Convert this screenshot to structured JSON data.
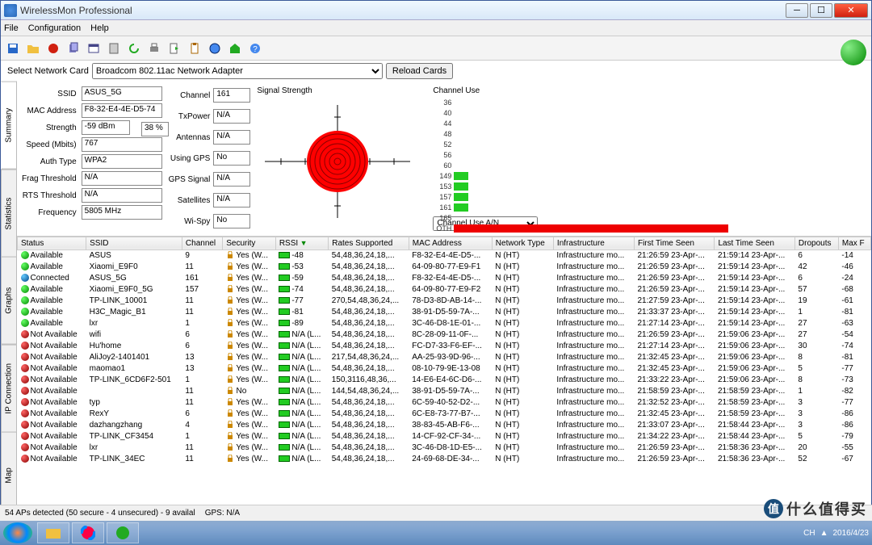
{
  "window": {
    "title": "WirelessMon Professional"
  },
  "menu": {
    "file": "File",
    "configuration": "Configuration",
    "help": "Help"
  },
  "cardrow": {
    "label": "Select Network Card",
    "selected": "Broadcom 802.11ac Network Adapter",
    "reload": "Reload Cards"
  },
  "sidetabs": {
    "summary": "Summary",
    "statistics": "Statistics",
    "graphs": "Graphs",
    "ipconn": "IP Connection",
    "map": "Map"
  },
  "fields_left": {
    "ssid_lbl": "SSID",
    "ssid": "ASUS_5G",
    "mac_lbl": "MAC Address",
    "mac": "F8-32-E4-4E-D5-74",
    "strength_lbl": "Strength",
    "strength": "-59 dBm",
    "strength_pct": "38 %",
    "speed_lbl": "Speed (Mbits)",
    "speed": "767",
    "auth_lbl": "Auth Type",
    "auth": "WPA2",
    "frag_lbl": "Frag Threshold",
    "frag": "N/A",
    "rts_lbl": "RTS Threshold",
    "rts": "N/A",
    "freq_lbl": "Frequency",
    "freq": "5805 MHz"
  },
  "fields_right": {
    "channel_lbl": "Channel",
    "channel": "161",
    "txpower_lbl": "TxPower",
    "txpower": "N/A",
    "antennas_lbl": "Antennas",
    "antennas": "N/A",
    "gps_lbl": "Using GPS",
    "gps": "No",
    "gpssig_lbl": "GPS Signal",
    "gpssig": "N/A",
    "sat_lbl": "Satellites",
    "sat": "N/A",
    "wispy_lbl": "Wi-Spy",
    "wispy": "No"
  },
  "radar": {
    "hdr": "Signal Strength"
  },
  "chuse": {
    "hdr": "Channel Use",
    "labels": [
      "36",
      "40",
      "44",
      "48",
      "52",
      "56",
      "60",
      "149",
      "153",
      "157",
      "161",
      "165",
      "OTH"
    ],
    "dropdown": "Channel Use A/N"
  },
  "columns": [
    "Status",
    "SSID",
    "Channel",
    "Security",
    "RSSI",
    "Rates Supported",
    "MAC Address",
    "Network Type",
    "Infrastructure",
    "First Time Seen",
    "Last Time Seen",
    "Dropouts",
    "Max F"
  ],
  "rows": [
    {
      "st": "g",
      "status": "Available",
      "ssid": "ASUS",
      "ch": "9",
      "sec": "Yes (W...",
      "rssi": "-48",
      "rates": "54,48,36,24,18,...",
      "mac": "F8-32-E4-4E-D5-...",
      "nt": "N (HT)",
      "inf": "Infrastructure mo...",
      "fts": "21:26:59 23-Apr-...",
      "lts": "21:59:14 23-Apr-...",
      "drop": "6",
      "maxf": "-14"
    },
    {
      "st": "g",
      "status": "Available",
      "ssid": "Xiaomi_E9F0",
      "ch": "11",
      "sec": "Yes (W...",
      "rssi": "-53",
      "rates": "54,48,36,24,18,...",
      "mac": "64-09-80-77-E9-F1",
      "nt": "N (HT)",
      "inf": "Infrastructure mo...",
      "fts": "21:26:59 23-Apr-...",
      "lts": "21:59:14 23-Apr-...",
      "drop": "42",
      "maxf": "-46"
    },
    {
      "st": "b",
      "status": "Connected",
      "ssid": "ASUS_5G",
      "ch": "161",
      "sec": "Yes (W...",
      "rssi": "-59",
      "rates": "54,48,36,24,18,...",
      "mac": "F8-32-E4-4E-D5-...",
      "nt": "N (HT)",
      "inf": "Infrastructure mo...",
      "fts": "21:26:59 23-Apr-...",
      "lts": "21:59:14 23-Apr-...",
      "drop": "6",
      "maxf": "-24"
    },
    {
      "st": "g",
      "status": "Available",
      "ssid": "Xiaomi_E9F0_5G",
      "ch": "157",
      "sec": "Yes (W...",
      "rssi": "-74",
      "rates": "54,48,36,24,18,...",
      "mac": "64-09-80-77-E9-F2",
      "nt": "N (HT)",
      "inf": "Infrastructure mo...",
      "fts": "21:26:59 23-Apr-...",
      "lts": "21:59:14 23-Apr-...",
      "drop": "57",
      "maxf": "-68"
    },
    {
      "st": "g",
      "status": "Available",
      "ssid": "TP-LINK_10001",
      "ch": "11",
      "sec": "Yes (W...",
      "rssi": "-77",
      "rates": "270,54,48,36,24,...",
      "mac": "78-D3-8D-AB-14-...",
      "nt": "N (HT)",
      "inf": "Infrastructure mo...",
      "fts": "21:27:59 23-Apr-...",
      "lts": "21:59:14 23-Apr-...",
      "drop": "19",
      "maxf": "-61"
    },
    {
      "st": "g",
      "status": "Available",
      "ssid": "H3C_Magic_B1",
      "ch": "11",
      "sec": "Yes (W...",
      "rssi": "-81",
      "rates": "54,48,36,24,18,...",
      "mac": "38-91-D5-59-7A-...",
      "nt": "N (HT)",
      "inf": "Infrastructure mo...",
      "fts": "21:33:37 23-Apr-...",
      "lts": "21:59:14 23-Apr-...",
      "drop": "1",
      "maxf": "-81"
    },
    {
      "st": "g",
      "status": "Available",
      "ssid": "lxr",
      "ch": "1",
      "sec": "Yes (W...",
      "rssi": "-89",
      "rates": "54,48,36,24,18,...",
      "mac": "3C-46-D8-1E-01-...",
      "nt": "N (HT)",
      "inf": "Infrastructure mo...",
      "fts": "21:27:14 23-Apr-...",
      "lts": "21:59:14 23-Apr-...",
      "drop": "27",
      "maxf": "-63"
    },
    {
      "st": "r",
      "status": "Not Available",
      "ssid": "wifi",
      "ch": "6",
      "sec": "Yes (W...",
      "rssi": "N/A (L...",
      "rates": "54,48,36,24,18,...",
      "mac": "8C-28-09-11-0F-...",
      "nt": "N (HT)",
      "inf": "Infrastructure mo...",
      "fts": "21:26:59 23-Apr-...",
      "lts": "21:59:06 23-Apr-...",
      "drop": "27",
      "maxf": "-54"
    },
    {
      "st": "r",
      "status": "Not Available",
      "ssid": "Hu'home",
      "ch": "6",
      "sec": "Yes (W...",
      "rssi": "N/A (L...",
      "rates": "54,48,36,24,18,...",
      "mac": "FC-D7-33-F6-EF-...",
      "nt": "N (HT)",
      "inf": "Infrastructure mo...",
      "fts": "21:27:14 23-Apr-...",
      "lts": "21:59:06 23-Apr-...",
      "drop": "30",
      "maxf": "-74"
    },
    {
      "st": "r",
      "status": "Not Available",
      "ssid": "AliJoy2-1401401",
      "ch": "13",
      "sec": "Yes (W...",
      "rssi": "N/A (L...",
      "rates": "217,54,48,36,24,...",
      "mac": "AA-25-93-9D-96-...",
      "nt": "N (HT)",
      "inf": "Infrastructure mo...",
      "fts": "21:32:45 23-Apr-...",
      "lts": "21:59:06 23-Apr-...",
      "drop": "8",
      "maxf": "-81"
    },
    {
      "st": "r",
      "status": "Not Available",
      "ssid": "maomao1",
      "ch": "13",
      "sec": "Yes (W...",
      "rssi": "N/A (L...",
      "rates": "54,48,36,24,18,...",
      "mac": "08-10-79-9E-13-08",
      "nt": "N (HT)",
      "inf": "Infrastructure mo...",
      "fts": "21:32:45 23-Apr-...",
      "lts": "21:59:06 23-Apr-...",
      "drop": "5",
      "maxf": "-77"
    },
    {
      "st": "r",
      "status": "Not Available",
      "ssid": "TP-LINK_6CD6F2-501",
      "ch": "1",
      "sec": "Yes (W...",
      "rssi": "N/A (L...",
      "rates": "150,3116,48,36,...",
      "mac": "14-E6-E4-6C-D6-...",
      "nt": "N (HT)",
      "inf": "Infrastructure mo...",
      "fts": "21:33:22 23-Apr-...",
      "lts": "21:59:06 23-Apr-...",
      "drop": "8",
      "maxf": "-73"
    },
    {
      "st": "r",
      "status": "Not Available",
      "ssid": "",
      "ch": "11",
      "sec": "No",
      "rssi": "N/A (L...",
      "rates": "144,54,48,36,24,...",
      "mac": "38-91-D5-59-7A-...",
      "nt": "N (HT)",
      "inf": "Infrastructure mo...",
      "fts": "21:58:59 23-Apr-...",
      "lts": "21:58:59 23-Apr-...",
      "drop": "1",
      "maxf": "-82"
    },
    {
      "st": "r",
      "status": "Not Available",
      "ssid": "typ",
      "ch": "11",
      "sec": "Yes (W...",
      "rssi": "N/A (L...",
      "rates": "54,48,36,24,18,...",
      "mac": "6C-59-40-52-D2-...",
      "nt": "N (HT)",
      "inf": "Infrastructure mo...",
      "fts": "21:32:52 23-Apr-...",
      "lts": "21:58:59 23-Apr-...",
      "drop": "3",
      "maxf": "-77"
    },
    {
      "st": "r",
      "status": "Not Available",
      "ssid": "RexY",
      "ch": "6",
      "sec": "Yes (W...",
      "rssi": "N/A (L...",
      "rates": "54,48,36,24,18,...",
      "mac": "6C-E8-73-77-B7-...",
      "nt": "N (HT)",
      "inf": "Infrastructure mo...",
      "fts": "21:32:45 23-Apr-...",
      "lts": "21:58:59 23-Apr-...",
      "drop": "3",
      "maxf": "-86"
    },
    {
      "st": "r",
      "status": "Not Available",
      "ssid": "dazhangzhang",
      "ch": "4",
      "sec": "Yes (W...",
      "rssi": "N/A (L...",
      "rates": "54,48,36,24,18,...",
      "mac": "38-83-45-AB-F6-...",
      "nt": "N (HT)",
      "inf": "Infrastructure mo...",
      "fts": "21:33:07 23-Apr-...",
      "lts": "21:58:44 23-Apr-...",
      "drop": "3",
      "maxf": "-86"
    },
    {
      "st": "r",
      "status": "Not Available",
      "ssid": "TP-LINK_CF3454",
      "ch": "1",
      "sec": "Yes (W...",
      "rssi": "N/A (L...",
      "rates": "54,48,36,24,18,...",
      "mac": "14-CF-92-CF-34-...",
      "nt": "N (HT)",
      "inf": "Infrastructure mo...",
      "fts": "21:34:22 23-Apr-...",
      "lts": "21:58:44 23-Apr-...",
      "drop": "5",
      "maxf": "-79"
    },
    {
      "st": "r",
      "status": "Not Available",
      "ssid": "lxr",
      "ch": "11",
      "sec": "Yes (W...",
      "rssi": "N/A (L...",
      "rates": "54,48,36,24,18,...",
      "mac": "3C-46-D8-1D-E5-...",
      "nt": "N (HT)",
      "inf": "Infrastructure mo...",
      "fts": "21:26:59 23-Apr-...",
      "lts": "21:58:36 23-Apr-...",
      "drop": "20",
      "maxf": "-55"
    },
    {
      "st": "r",
      "status": "Not Available",
      "ssid": "TP-LINK_34EC",
      "ch": "11",
      "sec": "Yes (W...",
      "rssi": "N/A (L...",
      "rates": "54,48,36,24,18,...",
      "mac": "24-69-68-DE-34-...",
      "nt": "N (HT)",
      "inf": "Infrastructure mo...",
      "fts": "21:26:59 23-Apr-...",
      "lts": "21:58:36 23-Apr-...",
      "drop": "52",
      "maxf": "-67"
    }
  ],
  "statusbar": {
    "aps": "54 APs detected (50 secure - 4 unsecured) - 9 availal",
    "gps": "GPS: N/A"
  },
  "taskbar": {
    "date": "2016/4/23",
    "ime": "CH"
  },
  "watermark": "什么值得买"
}
